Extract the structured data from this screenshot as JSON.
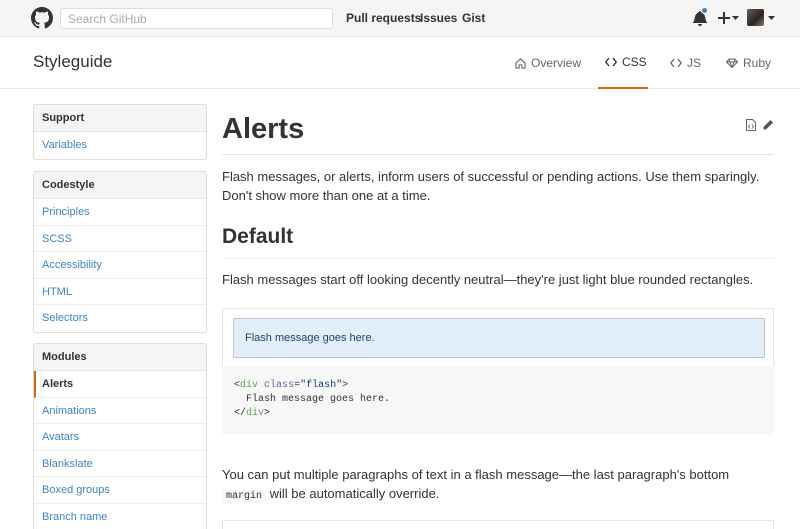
{
  "topbar": {
    "search_placeholder": "Search GitHub",
    "nav": [
      "Pull requests",
      "Issues",
      "Gist"
    ]
  },
  "styleguide": {
    "title": "Styleguide",
    "tabs": [
      {
        "label": "Overview",
        "icon": "home-icon"
      },
      {
        "label": "CSS",
        "icon": "code-icon",
        "active": true
      },
      {
        "label": "JS",
        "icon": "code-icon"
      },
      {
        "label": "Ruby",
        "icon": "ruby-icon"
      }
    ]
  },
  "sidebar": {
    "sections": [
      {
        "heading": "Support",
        "items": [
          "Variables"
        ]
      },
      {
        "heading": "Codestyle",
        "items": [
          "Principles",
          "SCSS",
          "Accessibility",
          "HTML",
          "Selectors"
        ]
      },
      {
        "heading": "Modules",
        "items": [
          "Alerts",
          "Animations",
          "Avatars",
          "Blankslate",
          "Boxed groups",
          "Branch name"
        ],
        "active": "Alerts"
      }
    ]
  },
  "main": {
    "title": "Alerts",
    "intro": "Flash messages, or alerts, inform users of successful or pending actions. Use them sparingly. Don't show more than one at a time.",
    "section_title": "Default",
    "section_text": "Flash messages start off looking decently neutral—they're just light blue rounded rectangles.",
    "flash_text": "Flash message goes here.",
    "code": {
      "tag": "div",
      "attr": "class",
      "value": "\"flash\"",
      "body": "Flash message goes here."
    },
    "para2_before": "You can put multiple paragraphs of text in a flash message—the last paragraph's bottom ",
    "para2_code": "margin",
    "para2_after": " will be automatically override."
  },
  "colors": {
    "accent": "#d26911",
    "link": "#4183c4",
    "flash_bg": "#e2eef9"
  }
}
